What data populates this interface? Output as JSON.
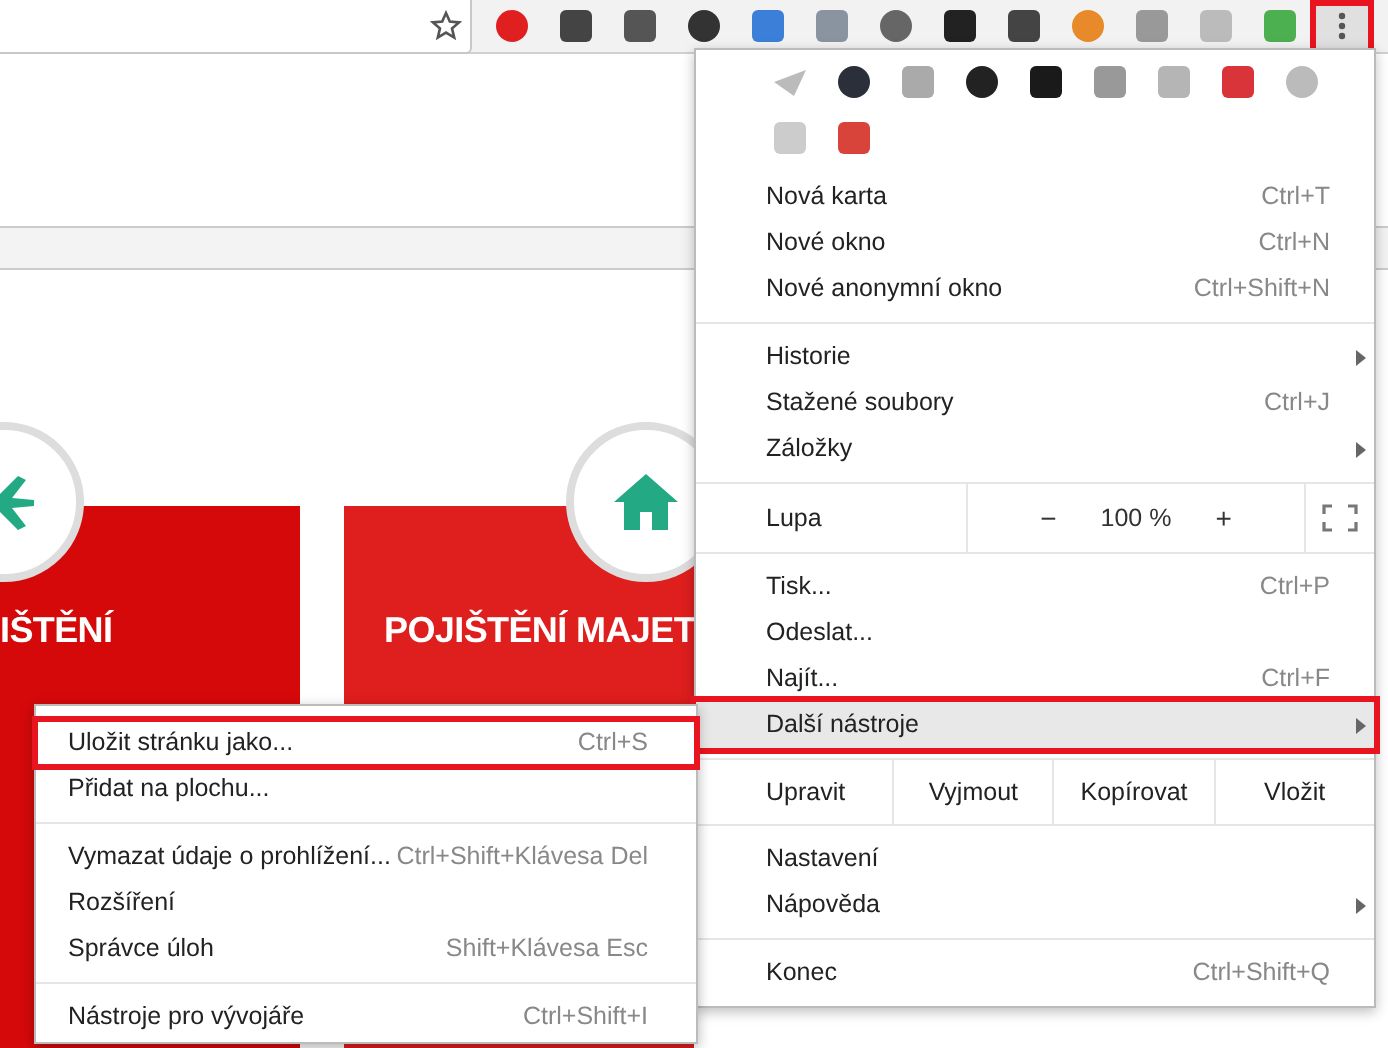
{
  "toolbar": {
    "menu_button": {
      "outlined": true
    }
  },
  "page": {
    "cards": [
      {
        "title": "IŠTĚNÍ"
      },
      {
        "title": "POJIŠTĚNÍ MAJET"
      }
    ]
  },
  "menu": {
    "sections": [
      {
        "items": [
          {
            "kind": "item",
            "label": "Nová karta",
            "shortcut": "Ctrl+T",
            "submenu": false,
            "selected": false,
            "outlined": false
          },
          {
            "kind": "item",
            "label": "Nové okno",
            "shortcut": "Ctrl+N",
            "submenu": false,
            "selected": false,
            "outlined": false
          },
          {
            "kind": "item",
            "label": "Nové anonymní okno",
            "shortcut": "Ctrl+Shift+N",
            "submenu": false,
            "selected": false,
            "outlined": false
          }
        ]
      },
      {
        "items": [
          {
            "kind": "item",
            "label": "Historie",
            "submenu": true,
            "selected": false,
            "outlined": false
          },
          {
            "kind": "item",
            "label": "Stažené soubory",
            "shortcut": "Ctrl+J",
            "submenu": false,
            "selected": false,
            "outlined": false
          },
          {
            "kind": "item",
            "label": "Záložky",
            "submenu": true,
            "selected": false,
            "outlined": false
          }
        ]
      },
      {
        "items": [
          {
            "kind": "zoom",
            "label": "Lupa",
            "minus": "−",
            "value": "100 %",
            "plus": "+"
          }
        ]
      },
      {
        "items": [
          {
            "kind": "item",
            "label": "Tisk...",
            "shortcut": "Ctrl+P",
            "submenu": false,
            "selected": false,
            "outlined": false
          },
          {
            "kind": "item",
            "label": "Odeslat...",
            "submenu": false,
            "selected": false,
            "outlined": false
          },
          {
            "kind": "item",
            "label": "Najít...",
            "shortcut": "Ctrl+F",
            "submenu": false,
            "selected": false,
            "outlined": false
          },
          {
            "kind": "item",
            "label": "Další nástroje",
            "submenu": true,
            "selected": true,
            "outlined": true
          }
        ]
      },
      {
        "items": [
          {
            "kind": "edit",
            "label": "Upravit",
            "actions": [
              "Vyjmout",
              "Kopírovat",
              "Vložit"
            ]
          }
        ]
      },
      {
        "items": [
          {
            "kind": "item",
            "label": "Nastavení",
            "submenu": false,
            "selected": false,
            "outlined": false
          },
          {
            "kind": "item",
            "label": "Nápověda",
            "submenu": true,
            "selected": false,
            "outlined": false
          }
        ]
      },
      {
        "items": [
          {
            "kind": "item",
            "label": "Konec",
            "shortcut": "Ctrl+Shift+Q",
            "submenu": false,
            "selected": false,
            "outlined": false
          }
        ]
      }
    ]
  },
  "submenu": {
    "sections": [
      {
        "items": [
          {
            "label": "Uložit stránku jako...",
            "shortcut": "Ctrl+S",
            "outlined": true
          },
          {
            "label": "Přidat na plochu...",
            "outlined": false
          }
        ]
      },
      {
        "items": [
          {
            "label": "Vymazat údaje o prohlížení...",
            "shortcut": "Ctrl+Shift+Klávesa Del",
            "outlined": false
          },
          {
            "label": "Rozšíření",
            "outlined": false
          },
          {
            "label": "Správce úloh",
            "shortcut": "Shift+Klávesa Esc",
            "outlined": false
          }
        ]
      },
      {
        "items": [
          {
            "label": "Nástroje pro vývojáře",
            "shortcut": "Ctrl+Shift+I",
            "outlined": false
          }
        ]
      }
    ]
  }
}
